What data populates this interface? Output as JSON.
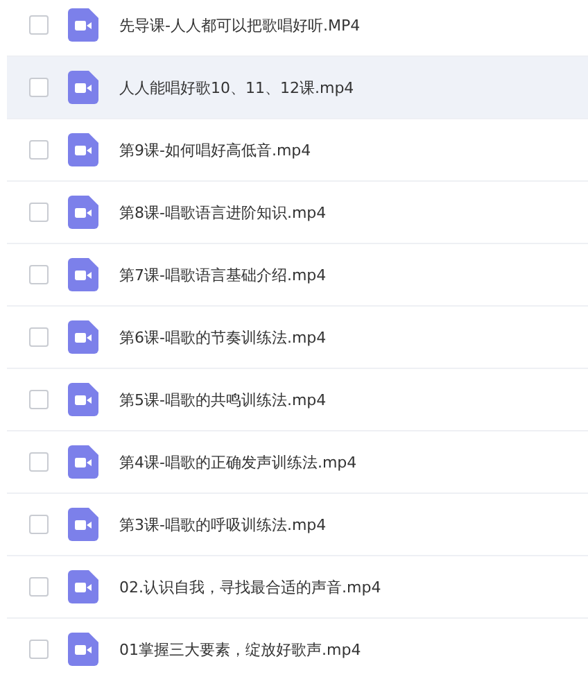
{
  "files": [
    {
      "name": "先导课-人人都可以把歌唱好听.MP4",
      "checked": false,
      "selected": false
    },
    {
      "name": "人人能唱好歌10、11、12课.mp4",
      "checked": false,
      "selected": true
    },
    {
      "name": "第9课-如何唱好高低音.mp4",
      "checked": false,
      "selected": false
    },
    {
      "name": "第8课-唱歌语言进阶知识.mp4",
      "checked": false,
      "selected": false
    },
    {
      "name": "第7课-唱歌语言基础介绍.mp4",
      "checked": false,
      "selected": false
    },
    {
      "name": "第6课-唱歌的节奏训练法.mp4",
      "checked": false,
      "selected": false
    },
    {
      "name": "第5课-唱歌的共鸣训练法.mp4",
      "checked": false,
      "selected": false
    },
    {
      "name": "第4课-唱歌的正确发声训练法.mp4",
      "checked": false,
      "selected": false
    },
    {
      "name": "第3课-唱歌的呼吸训练法.mp4",
      "checked": false,
      "selected": false
    },
    {
      "name": "02.认识自我，寻找最合适的声音.mp4",
      "checked": false,
      "selected": false
    },
    {
      "name": "01掌握三大要素，绽放好歌声.mp4",
      "checked": false,
      "selected": false
    }
  ]
}
